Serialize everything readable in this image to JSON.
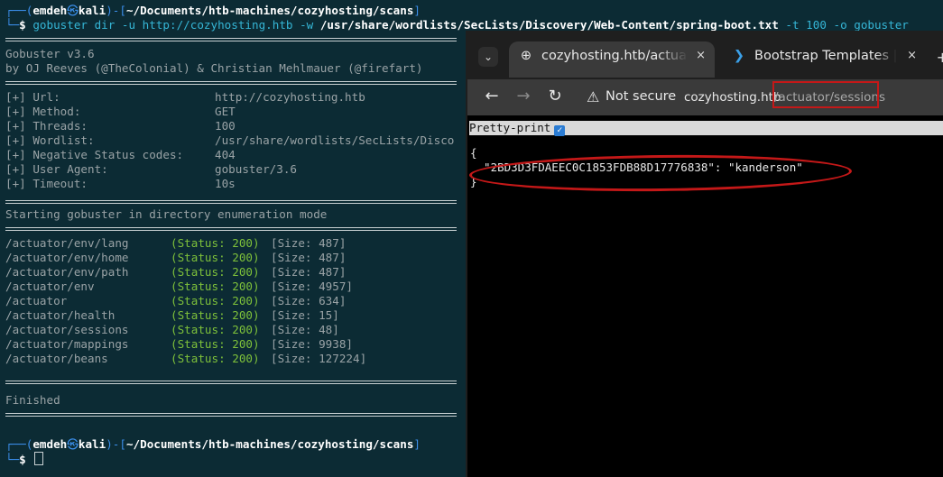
{
  "terminal": {
    "prompt_user": "emdeh",
    "prompt_symbol": "㉿",
    "prompt_host": "kali",
    "prompt_dir": "~/Documents/htb-machines/cozyhosting/scans",
    "command": {
      "cmd": "gobuster",
      "args1": " dir -u http://cozyhosting.htb ",
      "flag_w": "-w",
      "wordlist": " /usr/share/wordlists/SecLists/Discovery/Web-Content/spring-boot.txt",
      "args2": " -t 100 -o gobuster"
    },
    "banner_line1": "Gobuster v3.6",
    "banner_line2": "by OJ Reeves (@TheColonial) & Christian Mehlmauer (@firefart)",
    "config": [
      {
        "key": "[+] Url:",
        "value": "http://cozyhosting.htb"
      },
      {
        "key": "[+] Method:",
        "value": "GET"
      },
      {
        "key": "[+] Threads:",
        "value": "100"
      },
      {
        "key": "[+] Wordlist:",
        "value": "/usr/share/wordlists/SecLists/Disco"
      },
      {
        "key": "[+] Negative Status codes:",
        "value": "404"
      },
      {
        "key": "[+] User Agent:",
        "value": "gobuster/3.6"
      },
      {
        "key": "[+] Timeout:",
        "value": "10s"
      }
    ],
    "starting": "Starting gobuster in directory enumeration mode",
    "results": [
      {
        "path": "/actuator/env/lang",
        "status": "(Status: 200)",
        "size": "[Size: 487]"
      },
      {
        "path": "/actuator/env/home",
        "status": "(Status: 200)",
        "size": "[Size: 487]"
      },
      {
        "path": "/actuator/env/path",
        "status": "(Status: 200)",
        "size": "[Size: 487]"
      },
      {
        "path": "/actuator/env",
        "status": "(Status: 200)",
        "size": "[Size: 4957]"
      },
      {
        "path": "/actuator",
        "status": "(Status: 200)",
        "size": "[Size: 634]"
      },
      {
        "path": "/actuator/health",
        "status": "(Status: 200)",
        "size": "[Size: 15]"
      },
      {
        "path": "/actuator/sessions",
        "status": "(Status: 200)",
        "size": "[Size: 48]"
      },
      {
        "path": "/actuator/mappings",
        "status": "(Status: 200)",
        "size": "[Size: 9938]"
      },
      {
        "path": "/actuator/beans",
        "status": "(Status: 200)",
        "size": "[Size: 127224]"
      }
    ],
    "finished": "Finished"
  },
  "browser": {
    "tab_menu_icon": "chevron-down-icon",
    "tabs": [
      {
        "title": "cozyhosting.htb/actuator",
        "icon": "globe-icon",
        "close": "×"
      },
      {
        "title": "Bootstrap Templates | Pr",
        "icon": "bootstrap-logo-icon",
        "close": "×"
      }
    ],
    "new_tab": "+",
    "security_label": "Not secure",
    "url_host": "cozyhosting.htb",
    "url_path": "/actuator/sessions",
    "pretty_print_label": "Pretty-print",
    "pretty_print_checked": true,
    "json_open": "{",
    "json_entry": "  \"2BD3D3FDAEEC0C1853FDB88D17776838\": \"kanderson\"",
    "json_close": "}",
    "highlight_color": "#c41818"
  }
}
